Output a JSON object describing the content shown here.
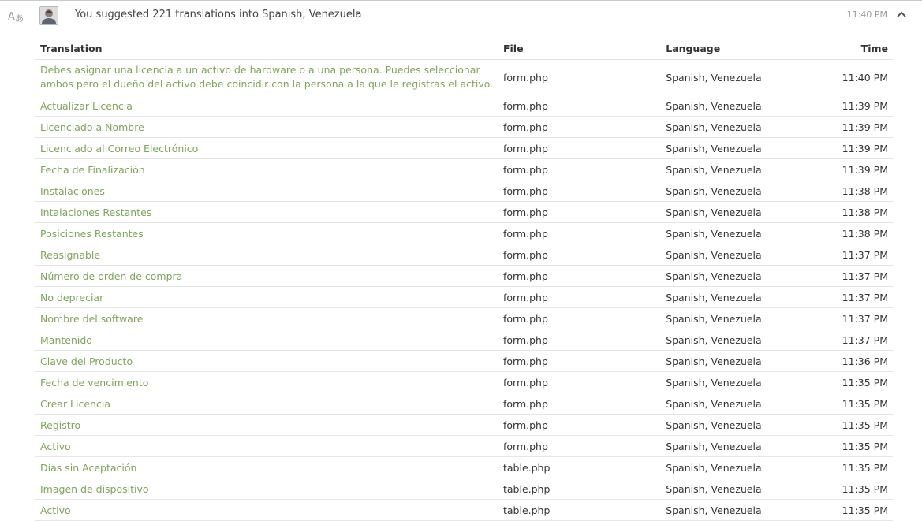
{
  "header": {
    "title": "You suggested 221 translations into Spanish, Venezuela",
    "time": "11:40 PM"
  },
  "colors": {
    "link": "#7ea55a",
    "text": "#333333",
    "muted": "#999999"
  },
  "table": {
    "columns": {
      "translation": "Translation",
      "file": "File",
      "language": "Language",
      "time": "Time"
    },
    "rows": [
      {
        "translation": "Debes asignar una licencia a un activo de hardware o a una persona. Puedes seleccionar ambos pero el dueño del activo debe coincidir con la persona a la que le registras el activo.",
        "file": "form.php",
        "language": "Spanish, Venezuela",
        "time": "11:40 PM"
      },
      {
        "translation": "Actualizar Licencia",
        "file": "form.php",
        "language": "Spanish, Venezuela",
        "time": "11:39 PM"
      },
      {
        "translation": "Licenciado a Nombre",
        "file": "form.php",
        "language": "Spanish, Venezuela",
        "time": "11:39 PM"
      },
      {
        "translation": "Licenciado al Correo Electrónico",
        "file": "form.php",
        "language": "Spanish, Venezuela",
        "time": "11:39 PM"
      },
      {
        "translation": "Fecha de Finalización",
        "file": "form.php",
        "language": "Spanish, Venezuela",
        "time": "11:39 PM"
      },
      {
        "translation": "Instalaciones",
        "file": "form.php",
        "language": "Spanish, Venezuela",
        "time": "11:38 PM"
      },
      {
        "translation": "Intalaciones Restantes",
        "file": "form.php",
        "language": "Spanish, Venezuela",
        "time": "11:38 PM"
      },
      {
        "translation": "Posiciones Restantes",
        "file": "form.php",
        "language": "Spanish, Venezuela",
        "time": "11:38 PM"
      },
      {
        "translation": "Reasignable",
        "file": "form.php",
        "language": "Spanish, Venezuela",
        "time": "11:37 PM"
      },
      {
        "translation": "Número de orden de compra",
        "file": "form.php",
        "language": "Spanish, Venezuela",
        "time": "11:37 PM"
      },
      {
        "translation": "No depreciar",
        "file": "form.php",
        "language": "Spanish, Venezuela",
        "time": "11:37 PM"
      },
      {
        "translation": "Nombre del software",
        "file": "form.php",
        "language": "Spanish, Venezuela",
        "time": "11:37 PM"
      },
      {
        "translation": "Mantenido",
        "file": "form.php",
        "language": "Spanish, Venezuela",
        "time": "11:37 PM"
      },
      {
        "translation": "Clave del Producto",
        "file": "form.php",
        "language": "Spanish, Venezuela",
        "time": "11:36 PM"
      },
      {
        "translation": "Fecha de vencimiento",
        "file": "form.php",
        "language": "Spanish, Venezuela",
        "time": "11:35 PM"
      },
      {
        "translation": "Crear Licencia",
        "file": "form.php",
        "language": "Spanish, Venezuela",
        "time": "11:35 PM"
      },
      {
        "translation": "Registro",
        "file": "form.php",
        "language": "Spanish, Venezuela",
        "time": "11:35 PM"
      },
      {
        "translation": "Activo",
        "file": "form.php",
        "language": "Spanish, Venezuela",
        "time": "11:35 PM"
      },
      {
        "translation": "Días sin Aceptación",
        "file": "table.php",
        "language": "Spanish, Venezuela",
        "time": "11:35 PM"
      },
      {
        "translation": "Imagen de dispositivo",
        "file": "table.php",
        "language": "Spanish, Venezuela",
        "time": "11:35 PM"
      },
      {
        "translation": "Activo",
        "file": "table.php",
        "language": "Spanish, Venezuela",
        "time": "11:35 PM"
      }
    ]
  },
  "icons": {
    "activity_type": "translate-icon",
    "collapse": "chevron-up-icon",
    "user": "avatar"
  }
}
